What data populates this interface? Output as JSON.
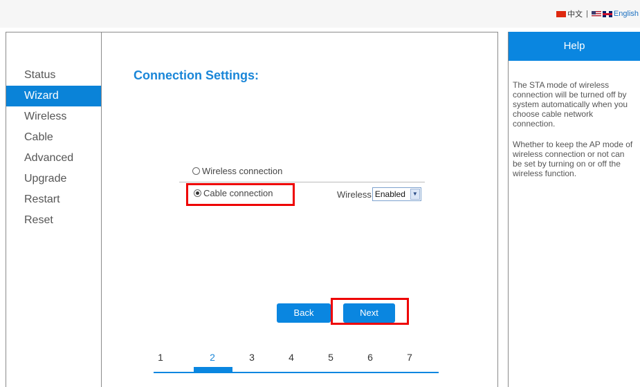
{
  "language": {
    "chinese_label": "中文",
    "separator": "|",
    "english_label": "English"
  },
  "sidebar": {
    "items": [
      {
        "label": "Status"
      },
      {
        "label": "Wizard"
      },
      {
        "label": "Wireless"
      },
      {
        "label": "Cable"
      },
      {
        "label": "Advanced"
      },
      {
        "label": "Upgrade"
      },
      {
        "label": "Restart"
      },
      {
        "label": "Reset"
      }
    ],
    "active": "Wizard"
  },
  "main": {
    "title": "Connection Settings:",
    "options": [
      {
        "label": "Wireless connection",
        "checked": false
      },
      {
        "label": "Cable connection",
        "checked": true
      }
    ],
    "wireless_label": "Wireless",
    "wireless_select": {
      "value": "Enabled"
    },
    "buttons": {
      "back": "Back",
      "next": "Next"
    },
    "steps": [
      "1",
      "2",
      "3",
      "4",
      "5",
      "6",
      "7"
    ],
    "current_step": "2"
  },
  "help": {
    "title": "Help",
    "paragraphs": [
      "The STA mode of wireless connection will be turned off by system automatically when you choose cable network connection.",
      "Whether to keep the AP mode of wireless connection or not can be set by turning on or off the wireless function."
    ]
  },
  "colors": {
    "accent": "#0a86e0",
    "highlight": "#ee0000"
  }
}
